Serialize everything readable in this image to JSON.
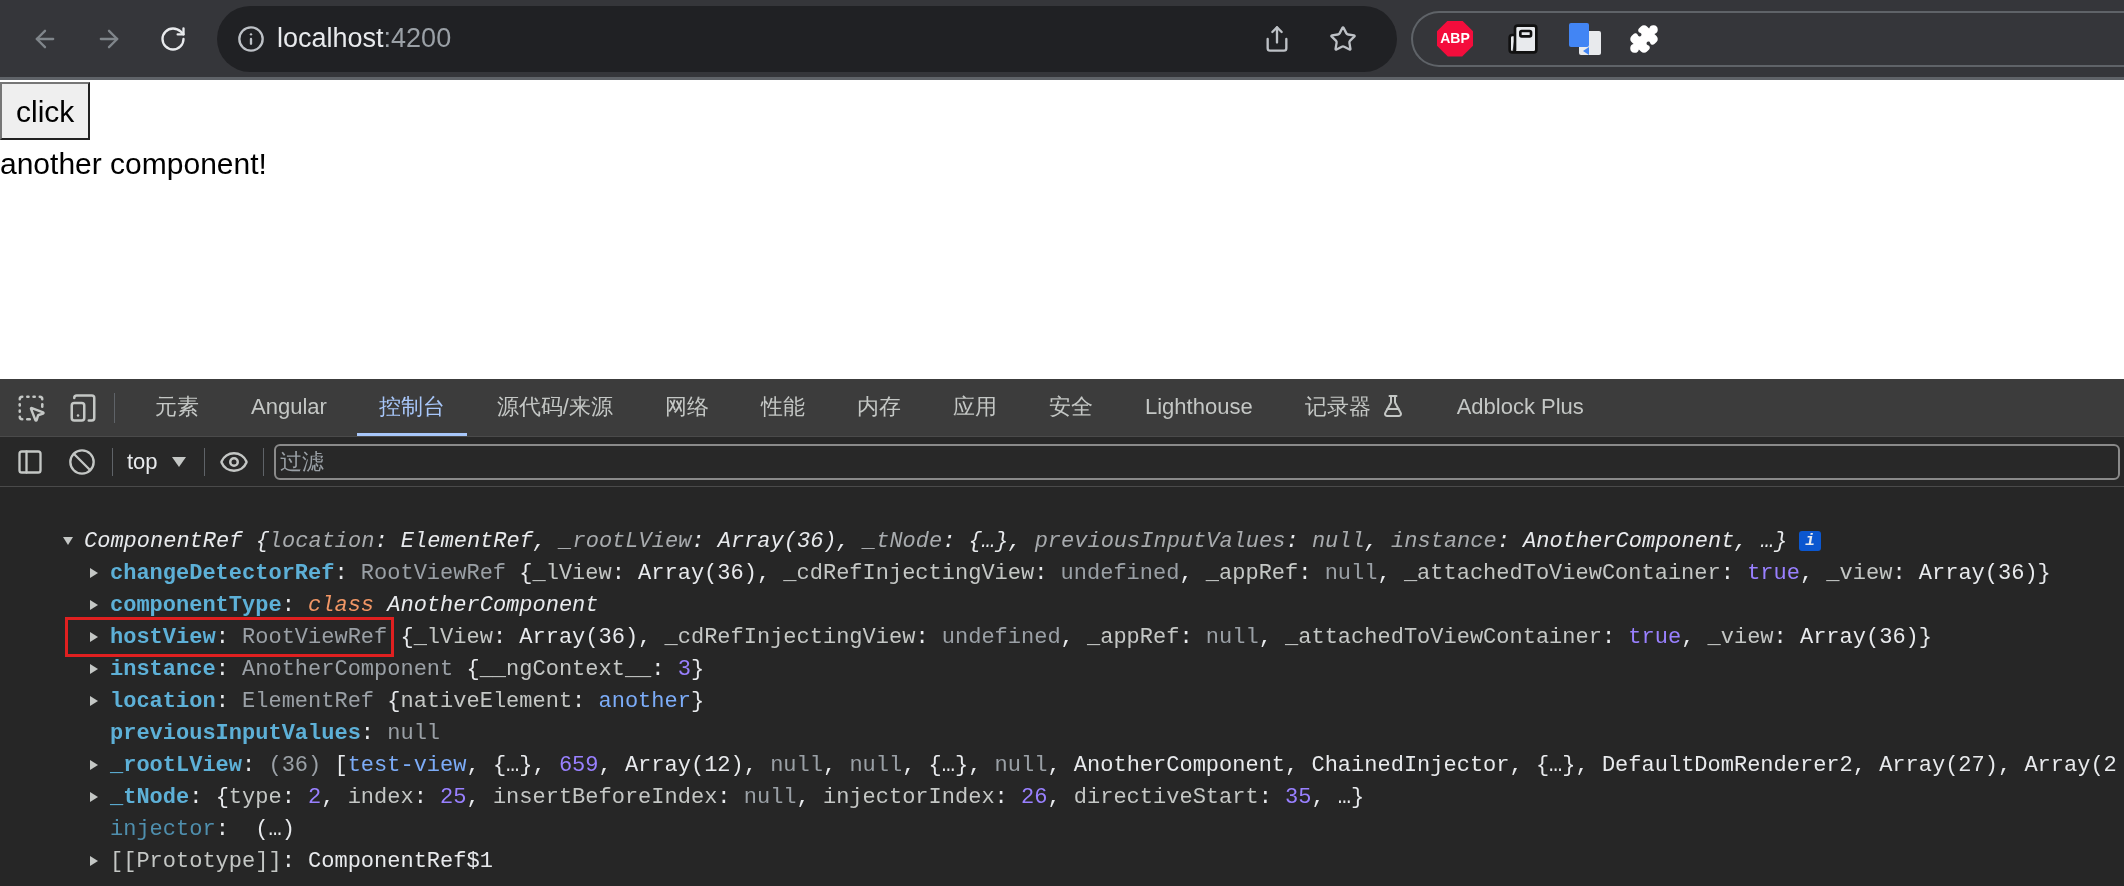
{
  "browser": {
    "address": {
      "host": "localhost",
      "port": ":4200"
    },
    "abp_label": "ABP"
  },
  "page": {
    "button": "click",
    "text": "another component!"
  },
  "devtools": {
    "tabs": [
      {
        "label": "元素",
        "selected": false
      },
      {
        "label": "Angular",
        "selected": false
      },
      {
        "label": "控制台",
        "selected": true
      },
      {
        "label": "源代码/来源",
        "selected": false
      },
      {
        "label": "网络",
        "selected": false
      },
      {
        "label": "性能",
        "selected": false
      },
      {
        "label": "内存",
        "selected": false
      },
      {
        "label": "应用",
        "selected": false
      },
      {
        "label": "安全",
        "selected": false
      },
      {
        "label": "Lighthouse",
        "selected": false
      },
      {
        "label": "记录器",
        "selected": false,
        "kind": "experiment"
      },
      {
        "label": "Adblock Plus",
        "selected": false
      }
    ],
    "context": "top",
    "filter": {
      "placeholder": "过滤"
    }
  },
  "console": {
    "rows": [
      {
        "kind": "object",
        "expanded": true,
        "badge": "i",
        "head": [
          {
            "kind": "italic",
            "text": "ComponentRef"
          }
        ],
        "tail": [
          {
            "kind": "italic",
            "text": " {"
          },
          {
            "kind": "italic-dim",
            "text": "location"
          },
          {
            "kind": "italic",
            "text": ": ElementRef, "
          },
          {
            "kind": "italic-dim",
            "text": "_rootLView"
          },
          {
            "kind": "italic",
            "text": ": Array(36), "
          },
          {
            "kind": "italic-dim",
            "text": "_tNode"
          },
          {
            "kind": "italic",
            "text": ": {…}, "
          },
          {
            "kind": "italic-dim",
            "text": "previousInputValues"
          },
          {
            "kind": "italic",
            "text": ": "
          },
          {
            "kind": "italic-dim",
            "text": "null"
          },
          {
            "kind": "italic",
            "text": ", "
          },
          {
            "kind": "italic-dim",
            "text": "instance"
          },
          {
            "kind": "italic",
            "text": ": AnotherComponent, …}"
          }
        ],
        "children": [
          {
            "kind": "object",
            "expanded": false,
            "head": [
              {
                "kind": "key",
                "text": "changeDetectorRef"
              },
              {
                "kind": "punct",
                "text": ": "
              },
              {
                "kind": "dim",
                "text": "RootViewRef"
              }
            ],
            "tail": [
              {
                "kind": "punct",
                "text": " {"
              },
              {
                "kind": "pkey",
                "text": "_lView"
              },
              {
                "kind": "punct",
                "text": ": Array(36), "
              },
              {
                "kind": "pkey",
                "text": "_cdRefInjectingView"
              },
              {
                "kind": "punct",
                "text": ": "
              },
              {
                "kind": "dim",
                "text": "undefined"
              },
              {
                "kind": "punct",
                "text": ", "
              },
              {
                "kind": "pkey",
                "text": "_appRef"
              },
              {
                "kind": "punct",
                "text": ": "
              },
              {
                "kind": "dim",
                "text": "null"
              },
              {
                "kind": "punct",
                "text": ", "
              },
              {
                "kind": "pkey",
                "text": "_attachedToViewContainer"
              },
              {
                "kind": "punct",
                "text": ": "
              },
              {
                "kind": "num",
                "text": "true"
              },
              {
                "kind": "punct",
                "text": ", "
              },
              {
                "kind": "pkey",
                "text": "_view"
              },
              {
                "kind": "punct",
                "text": ": Array(36)}"
              }
            ]
          },
          {
            "kind": "object",
            "expanded": false,
            "head": [
              {
                "kind": "key",
                "text": "componentType"
              },
              {
                "kind": "punct",
                "text": ": "
              },
              {
                "kind": "keyword",
                "text": "class"
              }
            ],
            "tail": [
              {
                "kind": "italic",
                "text": " AnotherComponent"
              }
            ]
          },
          {
            "kind": "object",
            "expanded": false,
            "annotated": true,
            "head": [
              {
                "kind": "key",
                "text": "hostView"
              },
              {
                "kind": "punct",
                "text": ": "
              },
              {
                "kind": "dim",
                "text": "RootViewRef"
              }
            ],
            "tail": [
              {
                "kind": "punct",
                "text": " {"
              },
              {
                "kind": "pkey",
                "text": "_lView"
              },
              {
                "kind": "punct",
                "text": ": Array(36), "
              },
              {
                "kind": "pkey",
                "text": "_cdRefInjectingView"
              },
              {
                "kind": "punct",
                "text": ": "
              },
              {
                "kind": "dim",
                "text": "undefined"
              },
              {
                "kind": "punct",
                "text": ", "
              },
              {
                "kind": "pkey",
                "text": "_appRef"
              },
              {
                "kind": "punct",
                "text": ": "
              },
              {
                "kind": "dim",
                "text": "null"
              },
              {
                "kind": "punct",
                "text": ", "
              },
              {
                "kind": "pkey",
                "text": "_attachedToViewContainer"
              },
              {
                "kind": "punct",
                "text": ": "
              },
              {
                "kind": "num",
                "text": "true"
              },
              {
                "kind": "punct",
                "text": ", "
              },
              {
                "kind": "pkey",
                "text": "_view"
              },
              {
                "kind": "punct",
                "text": ": Array(36)}"
              }
            ]
          },
          {
            "kind": "object",
            "expanded": false,
            "head": [
              {
                "kind": "key",
                "text": "instance"
              },
              {
                "kind": "punct",
                "text": ": "
              },
              {
                "kind": "dim",
                "text": "AnotherComponent"
              }
            ],
            "tail": [
              {
                "kind": "punct",
                "text": " {"
              },
              {
                "kind": "pkey",
                "text": "__ngContext__"
              },
              {
                "kind": "punct",
                "text": ": "
              },
              {
                "kind": "num",
                "text": "3"
              },
              {
                "kind": "punct",
                "text": "}"
              }
            ]
          },
          {
            "kind": "object",
            "expanded": false,
            "head": [
              {
                "kind": "key",
                "text": "location"
              },
              {
                "kind": "punct",
                "text": ": "
              },
              {
                "kind": "dim",
                "text": "ElementRef"
              }
            ],
            "tail": [
              {
                "kind": "punct",
                "text": " {"
              },
              {
                "kind": "pkey",
                "text": "nativeElement"
              },
              {
                "kind": "punct",
                "text": ": "
              },
              {
                "kind": "node",
                "text": "another"
              },
              {
                "kind": "punct",
                "text": "}"
              }
            ]
          },
          {
            "kind": "primitive",
            "head": [
              {
                "kind": "key",
                "text": "previousInputValues"
              },
              {
                "kind": "punct",
                "text": ": "
              },
              {
                "kind": "dim",
                "text": "null"
              }
            ]
          },
          {
            "kind": "object",
            "expanded": false,
            "head": [
              {
                "kind": "key",
                "text": "_rootLView"
              },
              {
                "kind": "punct",
                "text": ": "
              },
              {
                "kind": "dim",
                "text": "(36)"
              }
            ],
            "tail": [
              {
                "kind": "punct",
                "text": " ["
              },
              {
                "kind": "node",
                "text": "test-view"
              },
              {
                "kind": "punct",
                "text": ", {…}, "
              },
              {
                "kind": "num",
                "text": "659"
              },
              {
                "kind": "punct",
                "text": ", Array(12), "
              },
              {
                "kind": "dim",
                "text": "null"
              },
              {
                "kind": "punct",
                "text": ", "
              },
              {
                "kind": "dim",
                "text": "null"
              },
              {
                "kind": "punct",
                "text": ", {…}, "
              },
              {
                "kind": "dim",
                "text": "null"
              },
              {
                "kind": "punct",
                "text": ", AnotherComponent, ChainedInjector, {…}, DefaultDomRenderer2, Array(27), Array(2"
              }
            ]
          },
          {
            "kind": "object",
            "expanded": false,
            "head": [
              {
                "kind": "key",
                "text": "_tNode"
              },
              {
                "kind": "punct",
                "text": ": "
              }
            ],
            "tail": [
              {
                "kind": "punct",
                "text": "{"
              },
              {
                "kind": "pkey",
                "text": "type"
              },
              {
                "kind": "punct",
                "text": ": "
              },
              {
                "kind": "num",
                "text": "2"
              },
              {
                "kind": "punct",
                "text": ", "
              },
              {
                "kind": "pkey",
                "text": "index"
              },
              {
                "kind": "punct",
                "text": ": "
              },
              {
                "kind": "num",
                "text": "25"
              },
              {
                "kind": "punct",
                "text": ", "
              },
              {
                "kind": "pkey",
                "text": "insertBeforeIndex"
              },
              {
                "kind": "punct",
                "text": ": "
              },
              {
                "kind": "dim",
                "text": "null"
              },
              {
                "kind": "punct",
                "text": ", "
              },
              {
                "kind": "pkey",
                "text": "injectorIndex"
              },
              {
                "kind": "punct",
                "text": ": "
              },
              {
                "kind": "num",
                "text": "26"
              },
              {
                "kind": "punct",
                "text": ", "
              },
              {
                "kind": "pkey",
                "text": "directiveStart"
              },
              {
                "kind": "punct",
                "text": ": "
              },
              {
                "kind": "num",
                "text": "35"
              },
              {
                "kind": "punct",
                "text": ", …}"
              }
            ]
          },
          {
            "kind": "primitive",
            "head": [
              {
                "kind": "key-dim",
                "text": "injector"
              },
              {
                "kind": "punct",
                "text": ":  (…)"
              }
            ]
          },
          {
            "kind": "object",
            "expanded": false,
            "head": [
              {
                "kind": "pkey",
                "text": "[[Prototype]]"
              },
              {
                "kind": "punct",
                "text": ": ComponentRef$1"
              }
            ]
          }
        ]
      }
    ]
  }
}
